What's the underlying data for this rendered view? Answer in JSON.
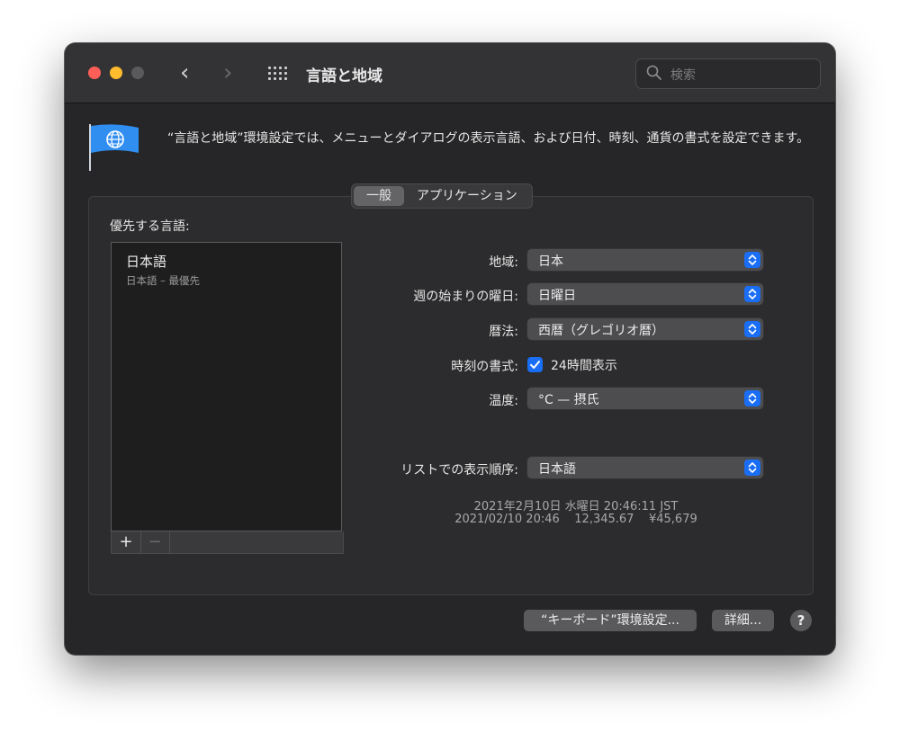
{
  "window": {
    "title": "言語と地域",
    "search_placeholder": "検索"
  },
  "description": "“言語と地域”環境設定では、メニューとダイアログの表示言語、および日付、時刻、通貨の書式を設定できます。",
  "tabs": [
    {
      "label": "一般",
      "selected": true
    },
    {
      "label": "アプリケーション",
      "selected": false
    }
  ],
  "preferred_languages": {
    "label": "優先する言語:",
    "items": [
      {
        "name": "日本語",
        "detail": "日本語 – 最優先"
      }
    ],
    "add_label": "+",
    "remove_label": "−"
  },
  "settings": {
    "region": {
      "label": "地域:",
      "value": "日本"
    },
    "first_day": {
      "label": "週の始まりの曜日:",
      "value": "日曜日"
    },
    "calendar": {
      "label": "暦法:",
      "value": "西暦（グレゴリオ暦）"
    },
    "time_format": {
      "label": "時刻の書式:",
      "checkbox_label": "24時間表示",
      "checked": true
    },
    "temperature": {
      "label": "温度:",
      "value": "°C — 摂氏"
    },
    "list_sort": {
      "label": "リストでの表示順序:",
      "value": "日本語"
    }
  },
  "sample": {
    "line1": "2021年2月10日 水曜日 20:46:11 JST",
    "line2": "2021/02/10 20:46    12,345.67    ¥45,679"
  },
  "buttons": {
    "keyboard_prefs": "“キーボード”環境設定...",
    "advanced": "詳細...",
    "help": "?"
  },
  "colors": {
    "accent": "#1a6ef5",
    "close": "#ff5f57",
    "minimize": "#febc2e"
  }
}
